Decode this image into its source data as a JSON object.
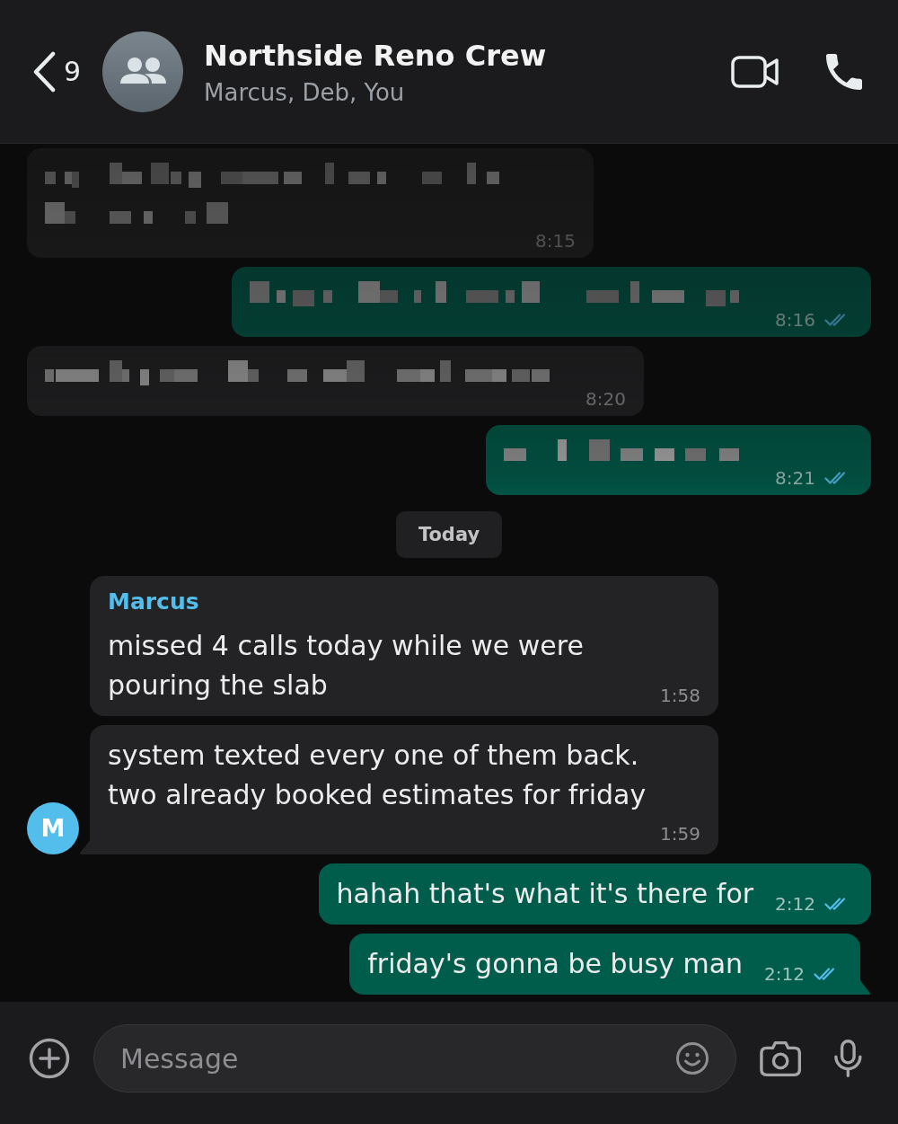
{
  "header": {
    "back_count": "9",
    "title": "Northside Reno Crew",
    "subtitle": "Marcus, Deb, You"
  },
  "messages": [
    {
      "kind": "redacted",
      "outgoing": false,
      "tail": false,
      "time": "8:15"
    },
    {
      "kind": "redacted",
      "outgoing": true,
      "tail": false,
      "time": "8:16",
      "read": true
    },
    {
      "kind": "redacted",
      "outgoing": false,
      "tail": false,
      "time": "8:20"
    },
    {
      "kind": "redacted",
      "outgoing": true,
      "tail": false,
      "time": "8:21",
      "read": true
    },
    {
      "kind": "date",
      "label": "Today"
    },
    {
      "kind": "text",
      "outgoing": false,
      "tail": false,
      "sender": "Marcus",
      "color": "#53bdeb",
      "text": "missed 4 calls today while we were\npouring the slab",
      "time": "1:58"
    },
    {
      "kind": "text",
      "outgoing": false,
      "tail": true,
      "avatar": "M",
      "color": "#53bdeb",
      "text": "system texted every one of them back.\ntwo already booked estimates for friday",
      "time": "1:59"
    },
    {
      "kind": "text",
      "outgoing": true,
      "tail": false,
      "text": "hahah that's what it's there for",
      "time": "2:12",
      "read": true
    },
    {
      "kind": "text",
      "outgoing": true,
      "tail": true,
      "text": "friday's gonna be busy man",
      "time": "2:12",
      "read": true
    }
  ],
  "composer": {
    "placeholder": "Message"
  }
}
